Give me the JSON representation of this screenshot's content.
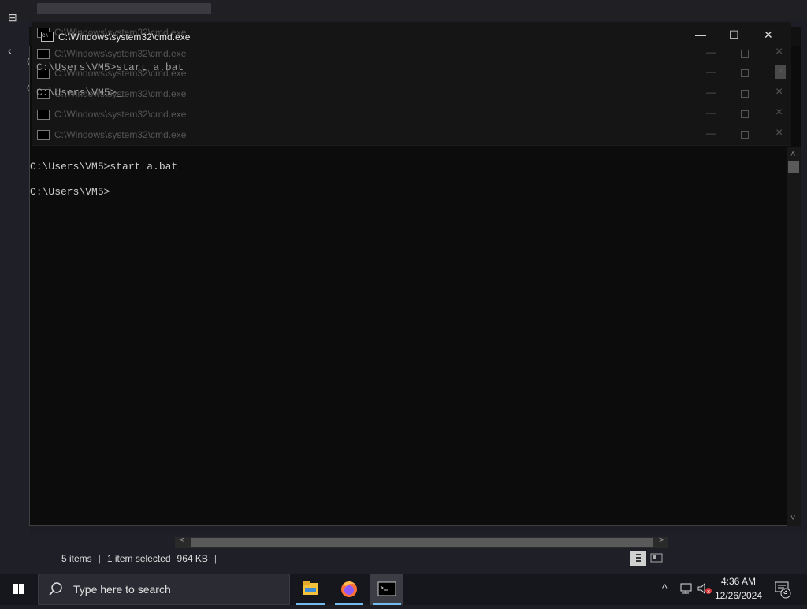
{
  "explorer": {
    "status": {
      "items": "5 items",
      "selected": "1 item selected",
      "size": "964 KB",
      "separator": "|"
    }
  },
  "cmd_stack": {
    "window_title": "C:\\Windows\\system32\\cmd.exe",
    "ghost_lines": [
      "C:\\Users\\VM5>start a.bat",
      "C:\\Users\\VM5>_"
    ],
    "ghost_letter": "C"
  },
  "cmd": {
    "title": "C:\\Windows\\system32\\cmd.exe",
    "icon_text": "C:\\",
    "output": "C:\\Users\\VM5>start a.bat\n\nC:\\Users\\VM5>",
    "minimize": "—",
    "maximize": "☐",
    "close": "✕"
  },
  "taskbar": {
    "search_placeholder": "Type here to search",
    "apps": [
      "file-explorer-icon",
      "firefox-icon",
      "cmd-icon"
    ],
    "time": "4:36 AM",
    "date": "12/26/2024",
    "notification_count": "3"
  },
  "colors": {
    "accent": "#76b9ed",
    "console_bg": "#0c0c0c",
    "console_text": "#cccccc"
  }
}
